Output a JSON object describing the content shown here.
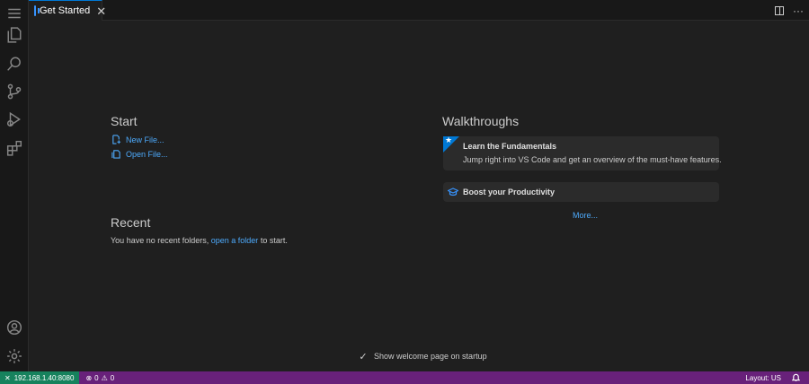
{
  "activity_bar": {
    "top_icons": [
      "menu-icon",
      "explorer-icon",
      "search-icon",
      "source-control-icon",
      "run-debug-icon",
      "extensions-icon"
    ],
    "bottom_icons": [
      "account-icon",
      "settings-gear-icon"
    ]
  },
  "tabs": [
    {
      "label": "Get Started",
      "close": "✕",
      "active": true
    }
  ],
  "tab_actions": {
    "more": "···"
  },
  "start": {
    "heading": "Start",
    "items": [
      {
        "label": "New File...",
        "icon": "new-file-icon"
      },
      {
        "label": "Open File...",
        "icon": "open-file-icon"
      }
    ]
  },
  "recent": {
    "heading": "Recent",
    "text_before": "You have no recent folders,",
    "link": "open a folder",
    "text_after": "to start."
  },
  "walkthroughs": {
    "heading": "Walkthroughs",
    "cards": [
      {
        "title": "Learn the Fundamentals",
        "description": "Jump right into VS Code and get an overview of the must-have features.",
        "icon": "star-icon"
      },
      {
        "title": "Boost your Productivity",
        "icon": "graduation-cap-icon"
      }
    ],
    "more": "More..."
  },
  "startup_checkbox": {
    "label": "Show welcome page on startup",
    "checked": true
  },
  "statusbar": {
    "remote": "192.168.1.40:8080",
    "errors": "0",
    "warnings": "0",
    "layout": "Layout: US"
  },
  "colors": {
    "accent": "#0078d4",
    "link": "#4daafc",
    "statusbar": "#68217a",
    "remote": "#16825d"
  }
}
